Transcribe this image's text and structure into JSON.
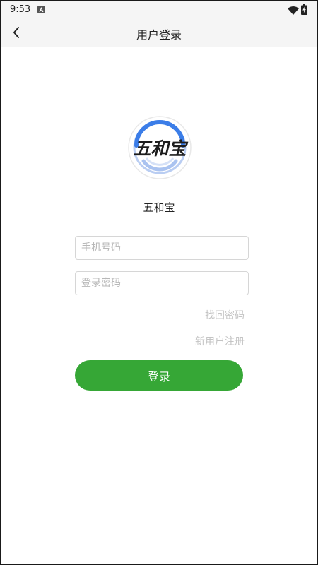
{
  "status_bar": {
    "time": "9:53",
    "icons": [
      "a-notification-icon",
      "wifi-icon",
      "battery-charging-icon"
    ]
  },
  "header": {
    "back_icon": "chevron-left-icon",
    "title": "用户登录"
  },
  "logo": {
    "text": "五和宝",
    "ring_color": "#3b7de8"
  },
  "app_name": "五和宝",
  "form": {
    "phone_placeholder": "手机号码",
    "phone_value": "",
    "password_placeholder": "登录密码",
    "password_value": ""
  },
  "links": {
    "forgot_password": "找回密码",
    "register": "新用户注册"
  },
  "login_button": {
    "label": "登录",
    "color": "#36a736"
  }
}
